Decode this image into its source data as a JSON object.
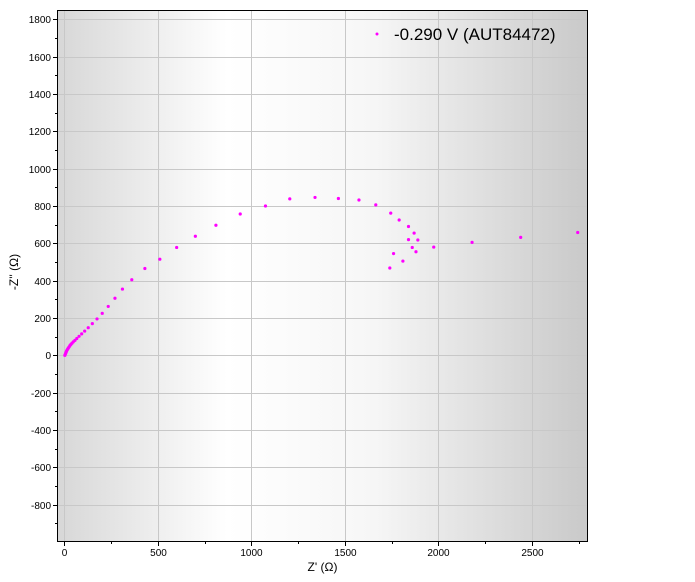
{
  "chart_data": {
    "type": "scatter",
    "xlabel": "Z' (Ω)",
    "ylabel": "-Z'' (Ω)",
    "xlim": [
      -40,
      2800
    ],
    "ylim": [
      -1000,
      1850
    ],
    "xticks": [
      0,
      500,
      1000,
      1500,
      2000,
      2500
    ],
    "yticks": [
      -800,
      -600,
      -400,
      -200,
      0,
      200,
      400,
      600,
      800,
      1000,
      1200,
      1400,
      1600,
      1800
    ],
    "grid": true,
    "legend_position": "top-right",
    "series": [
      {
        "name": "-0.290 V (AUT84472)",
        "color": "#ff00ff",
        "x": [
          2,
          4,
          6,
          8,
          10,
          12,
          15,
          18,
          21,
          25,
          29,
          34,
          40,
          47,
          56,
          66,
          78,
          92,
          108,
          127,
          149,
          174,
          202,
          234,
          270,
          310,
          360,
          430,
          510,
          600,
          700,
          810,
          940,
          1075,
          1205,
          1340,
          1465,
          1575,
          1665,
          1745,
          1790,
          1840,
          1870,
          1890,
          1975,
          1840,
          1860,
          1760,
          1880,
          1810,
          1740,
          2180,
          2440,
          2745
        ],
        "y": [
          0,
          5,
          10,
          15,
          20,
          25,
          30,
          35,
          40,
          45,
          52,
          58,
          65,
          72,
          80,
          90,
          102,
          115,
          130,
          148,
          170,
          195,
          225,
          262,
          306,
          355,
          405,
          465,
          515,
          578,
          638,
          697,
          757,
          800,
          838,
          846,
          840,
          832,
          806,
          762,
          725,
          690,
          655,
          618,
          580,
          620,
          578,
          545,
          555,
          505,
          468,
          605,
          632,
          658
        ]
      }
    ]
  }
}
